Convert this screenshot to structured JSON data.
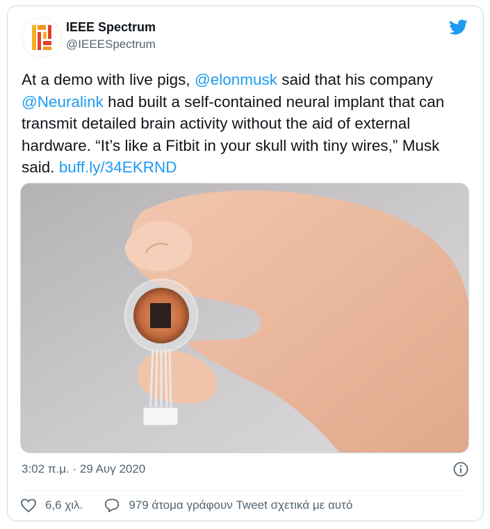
{
  "tweet": {
    "author": {
      "name": "IEEE Spectrum",
      "handle": "@IEEESpectrum",
      "avatar_icon": "ieee-spectrum-logo-icon"
    },
    "text": {
      "line1": {
        "pre": "At a demo with live pigs, ",
        "mention": "@elonmusk",
        "post": " said that his company"
      },
      "line2": {
        "mention": "@Neuralink",
        "post": " had built a self-contained neural implant that can"
      },
      "line3": "transmit detailed brain activity without the aid of external",
      "line4": "hardware. “It’s like a Fitbit in your skull with tiny wires,” Musk",
      "line5": {
        "pre": "said. ",
        "link": "buff.ly/34EKRND"
      }
    },
    "timestamp": "3:02 π.μ. · 29 Αυγ 2020",
    "likes": "6,6 χιλ.",
    "replies": "979 άτομα γράφουν Tweet σχετικά με αυτό"
  },
  "icons": {
    "platform": "twitter-bird-icon",
    "info": "info-icon",
    "like": "heart-icon",
    "reply": "reply-bubble-icon"
  },
  "colors": {
    "link": "#1d9bf0",
    "secondary_text": "#536471",
    "border": "#cfd9de"
  }
}
